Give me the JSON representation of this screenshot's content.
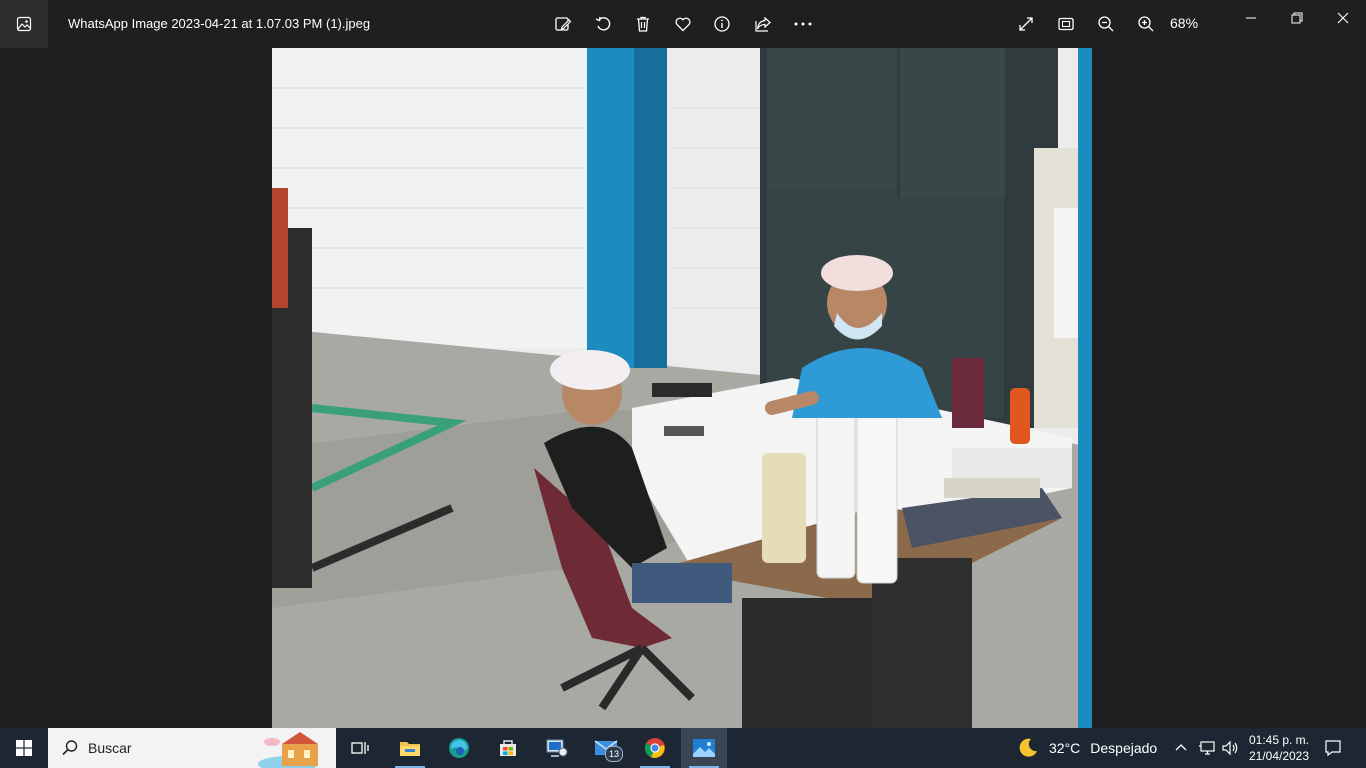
{
  "window": {
    "title": "WhatsApp Image 2023-04-21 at 1.07.03 PM (1).jpeg",
    "zoom": "68%",
    "toolbar_icons": [
      "edit-image-icon",
      "rotate-icon",
      "delete-icon",
      "favorite-icon",
      "info-icon",
      "share-icon",
      "more-icon"
    ],
    "view_icons": [
      "fullscreen-icon",
      "fit-window-icon",
      "zoom-out-icon",
      "zoom-in-icon"
    ],
    "window_controls": [
      "minimize-icon",
      "restore-icon",
      "close-icon"
    ]
  },
  "taskbar": {
    "search_placeholder": "Buscar",
    "apps": [
      "task-view-icon",
      "file-explorer-icon",
      "edge-icon",
      "store-icon",
      "network-app-icon",
      "mail-icon",
      "chrome-icon",
      "photos-icon"
    ],
    "mail_badge": "13",
    "weather": {
      "temp": "32°C",
      "condition": "Despejado"
    },
    "clock": {
      "time": "01:45 p. m.",
      "date": "21/04/2023"
    },
    "accent": "#7eb4ea"
  }
}
